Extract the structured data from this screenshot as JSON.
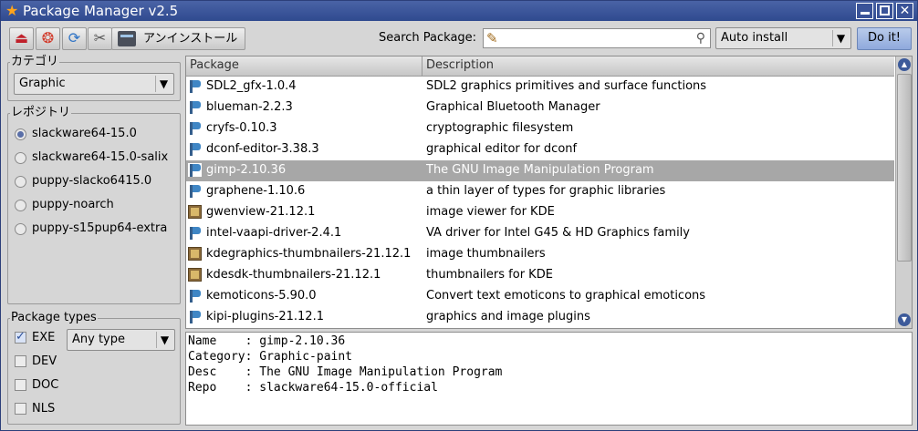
{
  "window": {
    "title": "Package Manager v2.5"
  },
  "toolbar": {
    "install_label": "アンインストール",
    "search_label": "Search Package:",
    "search_value": "",
    "mode_value": "Auto install",
    "doit_label": "Do it!"
  },
  "category": {
    "legend": "カテゴリ",
    "value": "Graphic"
  },
  "repos": {
    "legend": "レポジトリ",
    "items": [
      {
        "label": "slackware64-15.0",
        "selected": true
      },
      {
        "label": "slackware64-15.0-salix",
        "selected": false
      },
      {
        "label": "puppy-slacko6415.0",
        "selected": false
      },
      {
        "label": "puppy-noarch",
        "selected": false
      },
      {
        "label": "puppy-s15pup64-extra",
        "selected": false
      }
    ]
  },
  "types": {
    "legend": "Package types",
    "filter_value": "Any type",
    "items": [
      {
        "label": "EXE",
        "checked": true
      },
      {
        "label": "DEV",
        "checked": false
      },
      {
        "label": "DOC",
        "checked": false
      },
      {
        "label": "NLS",
        "checked": false
      }
    ]
  },
  "table": {
    "headers": {
      "package": "Package",
      "description": "Description"
    },
    "rows": [
      {
        "name": "SDL2_gfx-1.0.4",
        "desc": "SDL2 graphics primitives and surface functions",
        "icon": "package-icon"
      },
      {
        "name": "blueman-2.2.3",
        "desc": "Graphical Bluetooth Manager",
        "icon": "package-icon"
      },
      {
        "name": "cryfs-0.10.3",
        "desc": "cryptographic filesystem",
        "icon": "package-icon"
      },
      {
        "name": "dconf-editor-3.38.3",
        "desc": "graphical editor for dconf",
        "icon": "package-icon"
      },
      {
        "name": "gimp-2.10.36",
        "desc": "The GNU Image Manipulation Program",
        "icon": "package-icon",
        "selected": true
      },
      {
        "name": "graphene-1.10.6",
        "desc": "a thin layer of types for graphic libraries",
        "icon": "package-icon"
      },
      {
        "name": "gwenview-21.12.1",
        "desc": "image viewer for KDE",
        "icon": "image-package-icon"
      },
      {
        "name": "intel-vaapi-driver-2.4.1",
        "desc": "VA driver for Intel G45 & HD Graphics family",
        "icon": "package-icon"
      },
      {
        "name": "kdegraphics-thumbnailers-21.12.1",
        "desc": "image thumbnailers",
        "icon": "image-package-icon"
      },
      {
        "name": "kdesdk-thumbnailers-21.12.1",
        "desc": "thumbnailers for KDE",
        "icon": "image-package-icon"
      },
      {
        "name": "kemoticons-5.90.0",
        "desc": "Convert text emoticons to graphical emoticons",
        "icon": "package-icon"
      },
      {
        "name": "kipi-plugins-21.12.1",
        "desc": "graphics and image plugins",
        "icon": "package-icon"
      }
    ]
  },
  "details": {
    "lines": [
      "Name    : gimp-2.10.36",
      "Category: Graphic-paint",
      "Desc    : The GNU Image Manipulation Program",
      "Repo    : slackware64-15.0-official"
    ]
  }
}
